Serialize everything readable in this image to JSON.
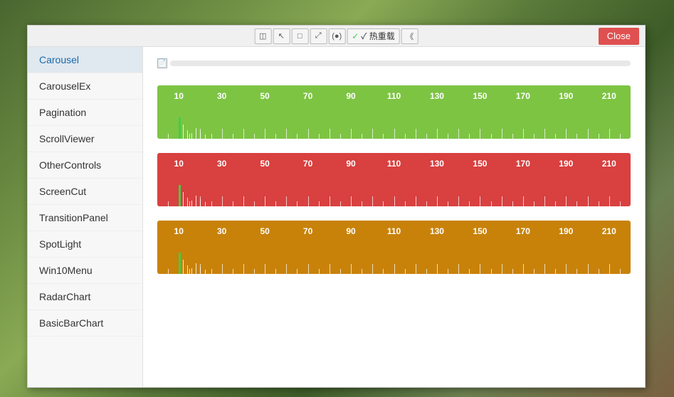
{
  "window": {
    "close_label": "Close",
    "toolbar": {
      "buttons": [
        {
          "icon": "◫",
          "name": "select-tool"
        },
        {
          "icon": "↖",
          "name": "cursor-tool"
        },
        {
          "icon": "□",
          "name": "rect-tool"
        },
        {
          "icon": "⤢",
          "name": "resize-tool"
        },
        {
          "icon": "(●)",
          "name": "circle-tool"
        },
        {
          "icon": "✓ 热重载",
          "name": "hot-reload"
        },
        {
          "icon": "《",
          "name": "collapse-tool"
        }
      ]
    }
  },
  "sidebar": {
    "items": [
      {
        "label": "Carousel",
        "active": true
      },
      {
        "label": "CarouselEx",
        "active": false
      },
      {
        "label": "Pagination",
        "active": false
      },
      {
        "label": "ScrollViewer",
        "active": false
      },
      {
        "label": "OtherControls",
        "active": false
      },
      {
        "label": "ScreenCut",
        "active": false
      },
      {
        "label": "TransitionPanel",
        "active": false
      },
      {
        "label": "SpotLight",
        "active": false
      },
      {
        "label": "Win10Menu",
        "active": false
      },
      {
        "label": "RadarChart",
        "active": false
      },
      {
        "label": "BasicBarChart",
        "active": false
      }
    ]
  },
  "main": {
    "rulers": [
      {
        "color": "green",
        "bg": "#7dc443",
        "numbers": [
          10,
          30,
          50,
          70,
          90,
          110,
          130,
          150,
          170,
          190,
          210
        ],
        "spike_color": "#44cc44"
      },
      {
        "color": "red",
        "bg": "#d94040",
        "numbers": [
          10,
          30,
          50,
          70,
          90,
          110,
          130,
          150,
          170,
          190,
          210
        ],
        "spike_color": "#44cc44"
      },
      {
        "color": "orange",
        "bg": "#c8820a",
        "numbers": [
          10,
          30,
          50,
          70,
          90,
          110,
          130,
          150,
          170,
          190,
          210
        ],
        "spike_color": "#44cc44"
      }
    ]
  }
}
